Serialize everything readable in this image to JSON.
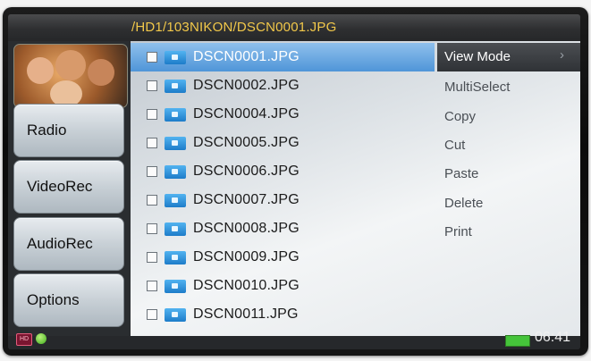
{
  "path": "/HD1/103NIKON/DSCN0001.JPG",
  "nav": {
    "items": [
      {
        "label": "Radio"
      },
      {
        "label": "VideoRec"
      },
      {
        "label": "AudioRec"
      },
      {
        "label": "Options"
      }
    ]
  },
  "files": [
    {
      "name": "DSCN0001.JPG",
      "selected": true
    },
    {
      "name": "DSCN0002.JPG"
    },
    {
      "name": "DSCN0004.JPG"
    },
    {
      "name": "DSCN0005.JPG"
    },
    {
      "name": "DSCN0006.JPG"
    },
    {
      "name": "DSCN0007.JPG"
    },
    {
      "name": "DSCN0008.JPG"
    },
    {
      "name": "DSCN0009.JPG"
    },
    {
      "name": "DSCN0010.JPG"
    },
    {
      "name": "DSCN0011.JPG"
    }
  ],
  "menu": {
    "items": [
      {
        "label": "View Mode",
        "selected": true
      },
      {
        "label": "MultiSelect"
      },
      {
        "label": "Copy"
      },
      {
        "label": "Cut"
      },
      {
        "label": "Paste"
      },
      {
        "label": "Delete"
      },
      {
        "label": "Print"
      }
    ]
  },
  "status": {
    "hd_badge": "HD",
    "clock": "06:41",
    "battery_color": "#45c43a",
    "led_color": "#3fae1d"
  },
  "colors": {
    "path_text": "#f2c84a",
    "selection_blue": "#4f95d8",
    "menu_highlight": "#2f3236"
  },
  "icons": [
    "folder-icon",
    "checkbox-icon",
    "chevron-right-icon",
    "hd-icon",
    "status-led-icon",
    "battery-icon"
  ]
}
